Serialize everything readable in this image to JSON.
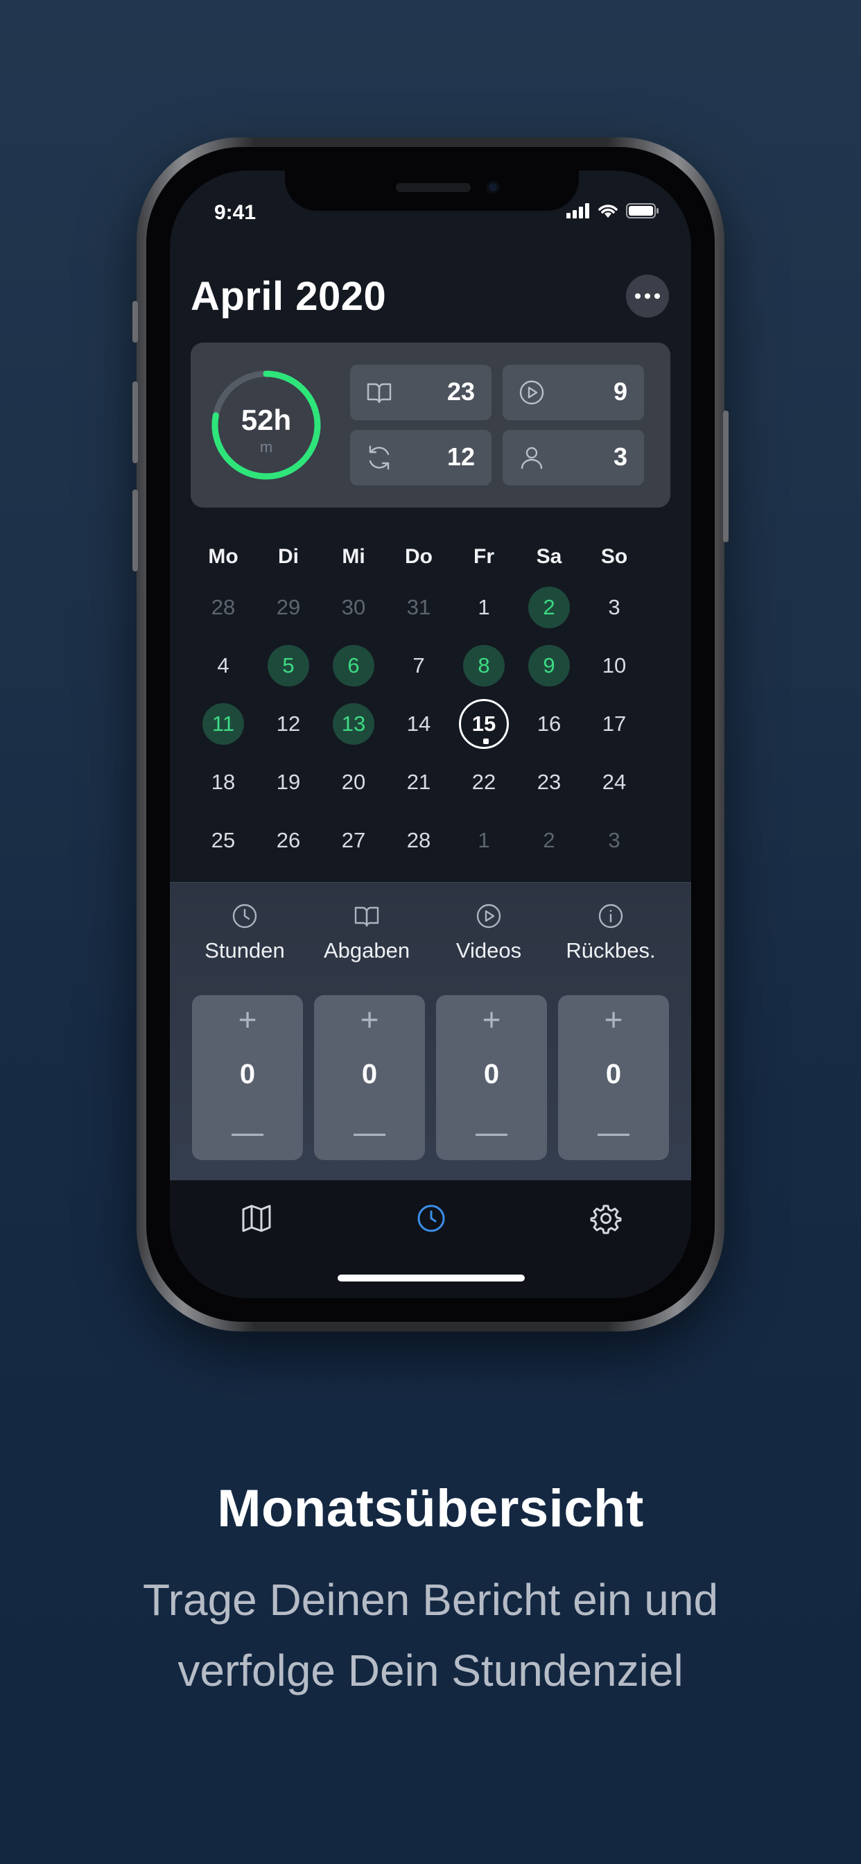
{
  "status_bar": {
    "time": "9:41"
  },
  "header": {
    "title": "April 2020"
  },
  "summary": {
    "hours_value": "52h",
    "hours_unit": "m",
    "ring_progress": 0.78,
    "ring_color": "#2ee57a",
    "stats": [
      {
        "icon": "book-icon",
        "value": "23"
      },
      {
        "icon": "play-icon",
        "value": "9"
      },
      {
        "icon": "refresh-icon",
        "value": "12"
      },
      {
        "icon": "person-icon",
        "value": "3"
      }
    ]
  },
  "calendar": {
    "weekdays": [
      "Mo",
      "Di",
      "Mi",
      "Do",
      "Fr",
      "Sa",
      "So"
    ],
    "weeks": [
      [
        "28",
        "29",
        "30",
        "31",
        "1",
        "2",
        "3"
      ],
      [
        "4",
        "5",
        "6",
        "7",
        "8",
        "9",
        "10"
      ],
      [
        "11",
        "12",
        "13",
        "14",
        "15",
        "16",
        "17"
      ],
      [
        "18",
        "19",
        "20",
        "21",
        "22",
        "23",
        "24"
      ],
      [
        "25",
        "26",
        "27",
        "28",
        "1",
        "2",
        "3"
      ]
    ],
    "highlighted_days": [
      "2",
      "5",
      "6",
      "8",
      "9",
      "11",
      "13"
    ],
    "today": "15"
  },
  "entry": {
    "categories": [
      {
        "icon": "clock-icon",
        "label": "Stunden",
        "value": "0"
      },
      {
        "icon": "book-icon",
        "label": "Abgaben",
        "value": "0"
      },
      {
        "icon": "play-icon",
        "label": "Videos",
        "value": "0"
      },
      {
        "icon": "info-icon",
        "label": "Rückbes.",
        "value": "0"
      }
    ],
    "plus_symbol": "+",
    "minus_symbol": "—"
  },
  "tabbar": {
    "tabs": [
      "map-icon",
      "clock-icon",
      "gear-icon"
    ],
    "active_color": "#3b8fe8"
  },
  "caption": {
    "headline": "Monatsübersicht",
    "subline_1": "Trage Deinen Bericht ein und",
    "subline_2": "verfolge Dein Stundenziel"
  }
}
